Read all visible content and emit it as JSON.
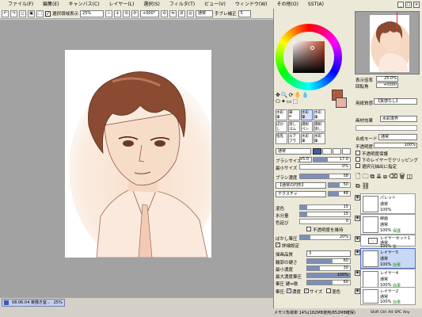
{
  "menubar": {
    "items": [
      "ファイル(F)",
      "編集(E)",
      "キャンバス(C)",
      "レイヤー(L)",
      "選択(S)",
      "フィルタ(T)",
      "ビュー(V)",
      "ウィンドウ(W)",
      "その他(O)",
      "SST(A)"
    ]
  },
  "toolbar": {
    "show_selection_label": "選択領域表示",
    "zoom": "25%",
    "rotation": "+000°",
    "blend": "通常",
    "stabilizer_label": "手ブレ補正",
    "stabilizer_value": "5"
  },
  "navigator": {
    "zoom_label": "表示倍率",
    "zoom_value": "25.0%",
    "angle_label": "回転角",
    "angle_value": "+0000"
  },
  "paper_effect": {
    "label": "用紙質感",
    "value": "【質感なし】"
  },
  "paper_effect2": {
    "label": "画材効果",
    "value": "水彩境界"
  },
  "blend_mode": {
    "label": "合成モード",
    "value": "通常"
  },
  "opacity": {
    "label": "不透明度",
    "value": "100%"
  },
  "layer_opts": {
    "protect": "不透明度保護",
    "clip": "下のレイヤーでクリッピング",
    "select_src": "選択元抽出に指定"
  },
  "brush_tools": [
    {
      "label": "水彩筆",
      "sel": false
    },
    {
      "label": "筆",
      "sel": false
    },
    {
      "label": "水彩筆",
      "sel": true
    },
    {
      "label": "水彩筆",
      "sel": false
    },
    {
      "label": "ぼかし",
      "sel": false
    },
    {
      "label": "消しゴム",
      "sel": false
    },
    {
      "label": "選択ペン",
      "sel": false
    },
    {
      "label": "選択消し",
      "sel": false
    },
    {
      "label": "指先",
      "sel": false
    },
    {
      "label": "エアブラシ",
      "sel": false
    },
    {
      "label": "水彩筆",
      "sel": false
    },
    {
      "label": "水彩筆",
      "sel": false
    }
  ],
  "tool_settings": {
    "mode": "通常",
    "size_label": "ブラシサイズ",
    "size_mult": "x5.0",
    "size_value": "17.0",
    "min_size_label": "最小サイズ",
    "min_size_value": "0%",
    "density_label": "ブラシ濃度",
    "density_value": "58",
    "shape_label": "【通常の円形】",
    "shape_value": "50",
    "texture_label": "テクスチャ",
    "texture_value": "48",
    "blend_label": "混色",
    "blend_value": "15",
    "water_label": "水分量",
    "water_value": "15",
    "persist_label": "色延び",
    "persist_value": "0",
    "keep_opacity": "不透明度を維持",
    "blur_label": "ぼかし筆圧",
    "blur_value": "20%",
    "detail_label": "詳細設定",
    "quality_label": "描画品質",
    "quality_value": "3",
    "edge_label": "輪郭の硬さ",
    "edge_value": "60",
    "min_density_label": "最小濃度",
    "min_density_value": "30",
    "max_pressure_label": "最大濃度筆圧",
    "max_pressure_value": "100%",
    "hard_soft_label": "筆圧 硬⇔軟",
    "hard_soft_value": "60",
    "pressure_label": "筆圧:",
    "pressure_density": "濃度",
    "pressure_size": "サイズ",
    "pressure_mix": "混色"
  },
  "layers": [
    {
      "name": "パレット",
      "mode": "通常",
      "opacity": "100%",
      "sel": false
    },
    {
      "name": "線画",
      "mode": "通常",
      "opacity": "100%",
      "extra": "保護",
      "sel": false
    },
    {
      "name": "レイヤーセット1",
      "mode": "通常",
      "opacity": "100%",
      "extra": "覧",
      "folder": true,
      "sel": false
    },
    {
      "name": "レイヤー5",
      "mode": "通常",
      "opacity": "100%",
      "extra": "効果",
      "sel": true
    },
    {
      "name": "レイヤー4",
      "mode": "通常",
      "opacity": "100%",
      "extra": "効果",
      "sel": false
    },
    {
      "name": "レイヤー2",
      "mode": "通常",
      "opacity": "100%",
      "extra": "効果",
      "sel": false
    }
  ],
  "memory_status": "メモリ負荷率 14%(182MB使用/852MB確保)",
  "key_status": [
    "Shift",
    "Ctrl",
    "Alt",
    "SPC",
    "Any"
  ],
  "taskbar": {
    "doc_label": "08.06.04 楽描き室...",
    "doc_zoom": "25%"
  },
  "colors": {
    "main": "#b45a3a",
    "sub": "#e9b3a5"
  }
}
